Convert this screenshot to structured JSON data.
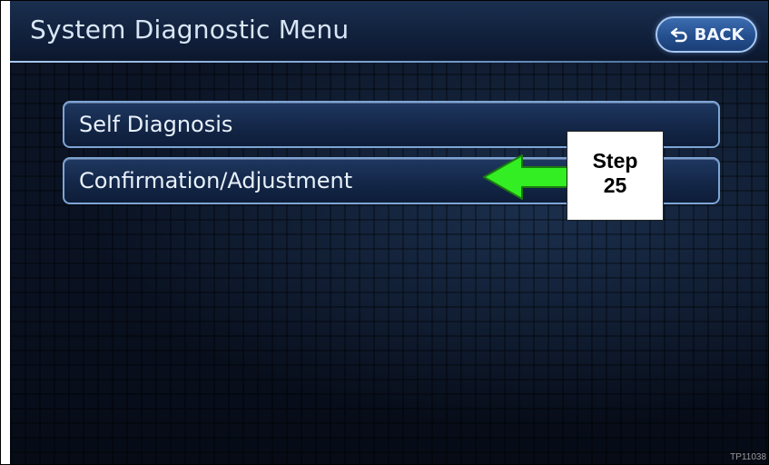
{
  "header": {
    "title": "System Diagnostic Menu",
    "back_label": "BACK"
  },
  "menu": {
    "items": [
      {
        "label": "Self Diagnosis"
      },
      {
        "label": "Confirmation/Adjustment"
      }
    ]
  },
  "annotation": {
    "callout_line1": "Step",
    "callout_line2": "25",
    "arrow_color": "#33ee22"
  },
  "watermark": "TP11038",
  "colors": {
    "header_title": "#d9e6f5",
    "button_border": "#7ea4d4",
    "back_button": "#2d5a9c"
  },
  "icons": {
    "back": "return-arrow-icon"
  }
}
